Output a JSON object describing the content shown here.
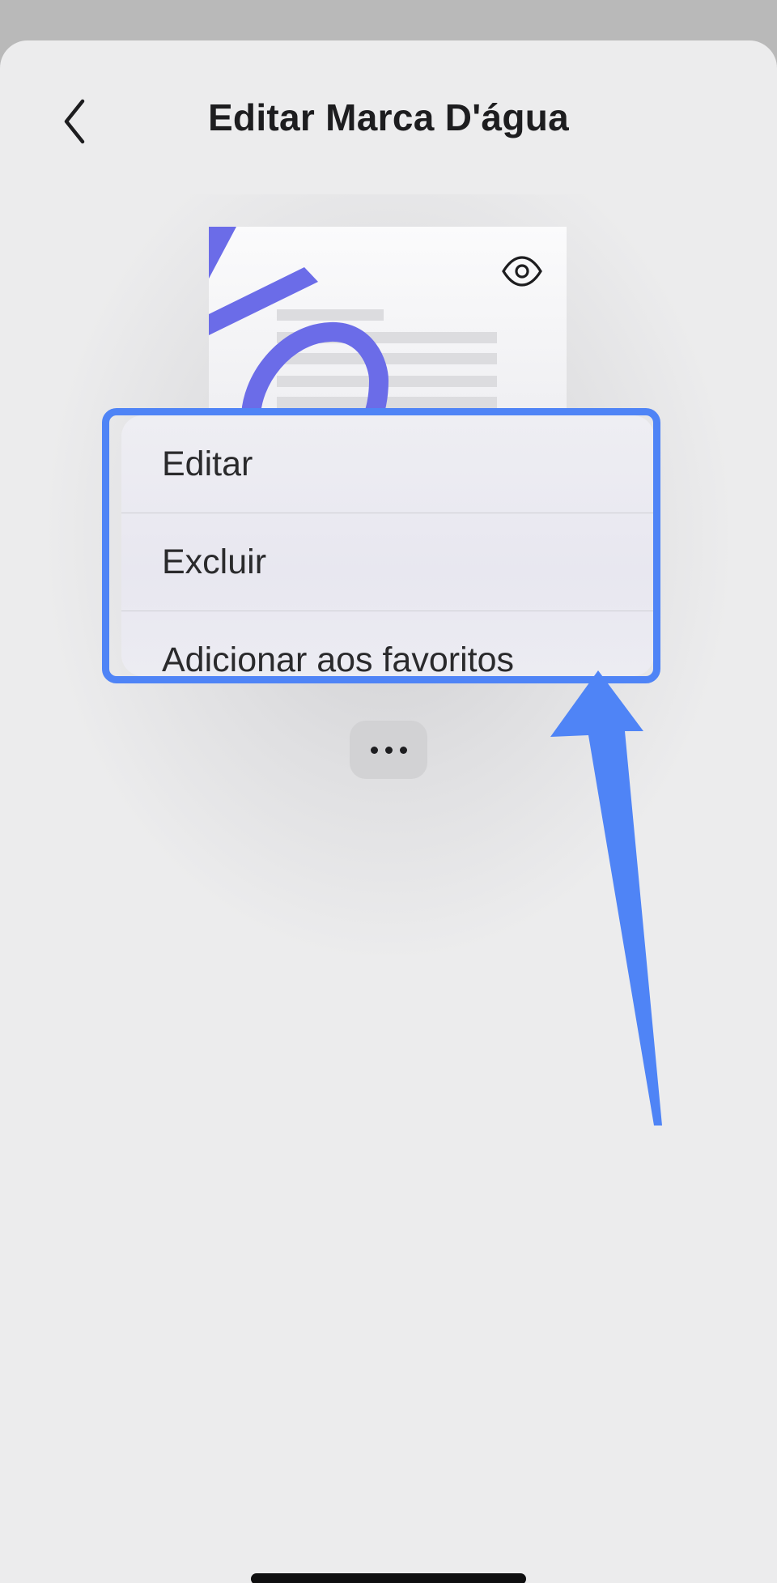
{
  "header": {
    "title": "Editar Marca D'água",
    "back_icon": "chevron-left-icon"
  },
  "preview": {
    "eye_icon": "eye-icon",
    "accent_color": "#6b6ce8"
  },
  "context_menu": {
    "items": [
      {
        "label": "Editar"
      },
      {
        "label": "Excluir"
      },
      {
        "label": "Adicionar aos favoritos"
      }
    ]
  },
  "more_button": {
    "icon": "ellipsis-icon"
  },
  "annotation": {
    "highlight_color": "#4f84f6"
  }
}
